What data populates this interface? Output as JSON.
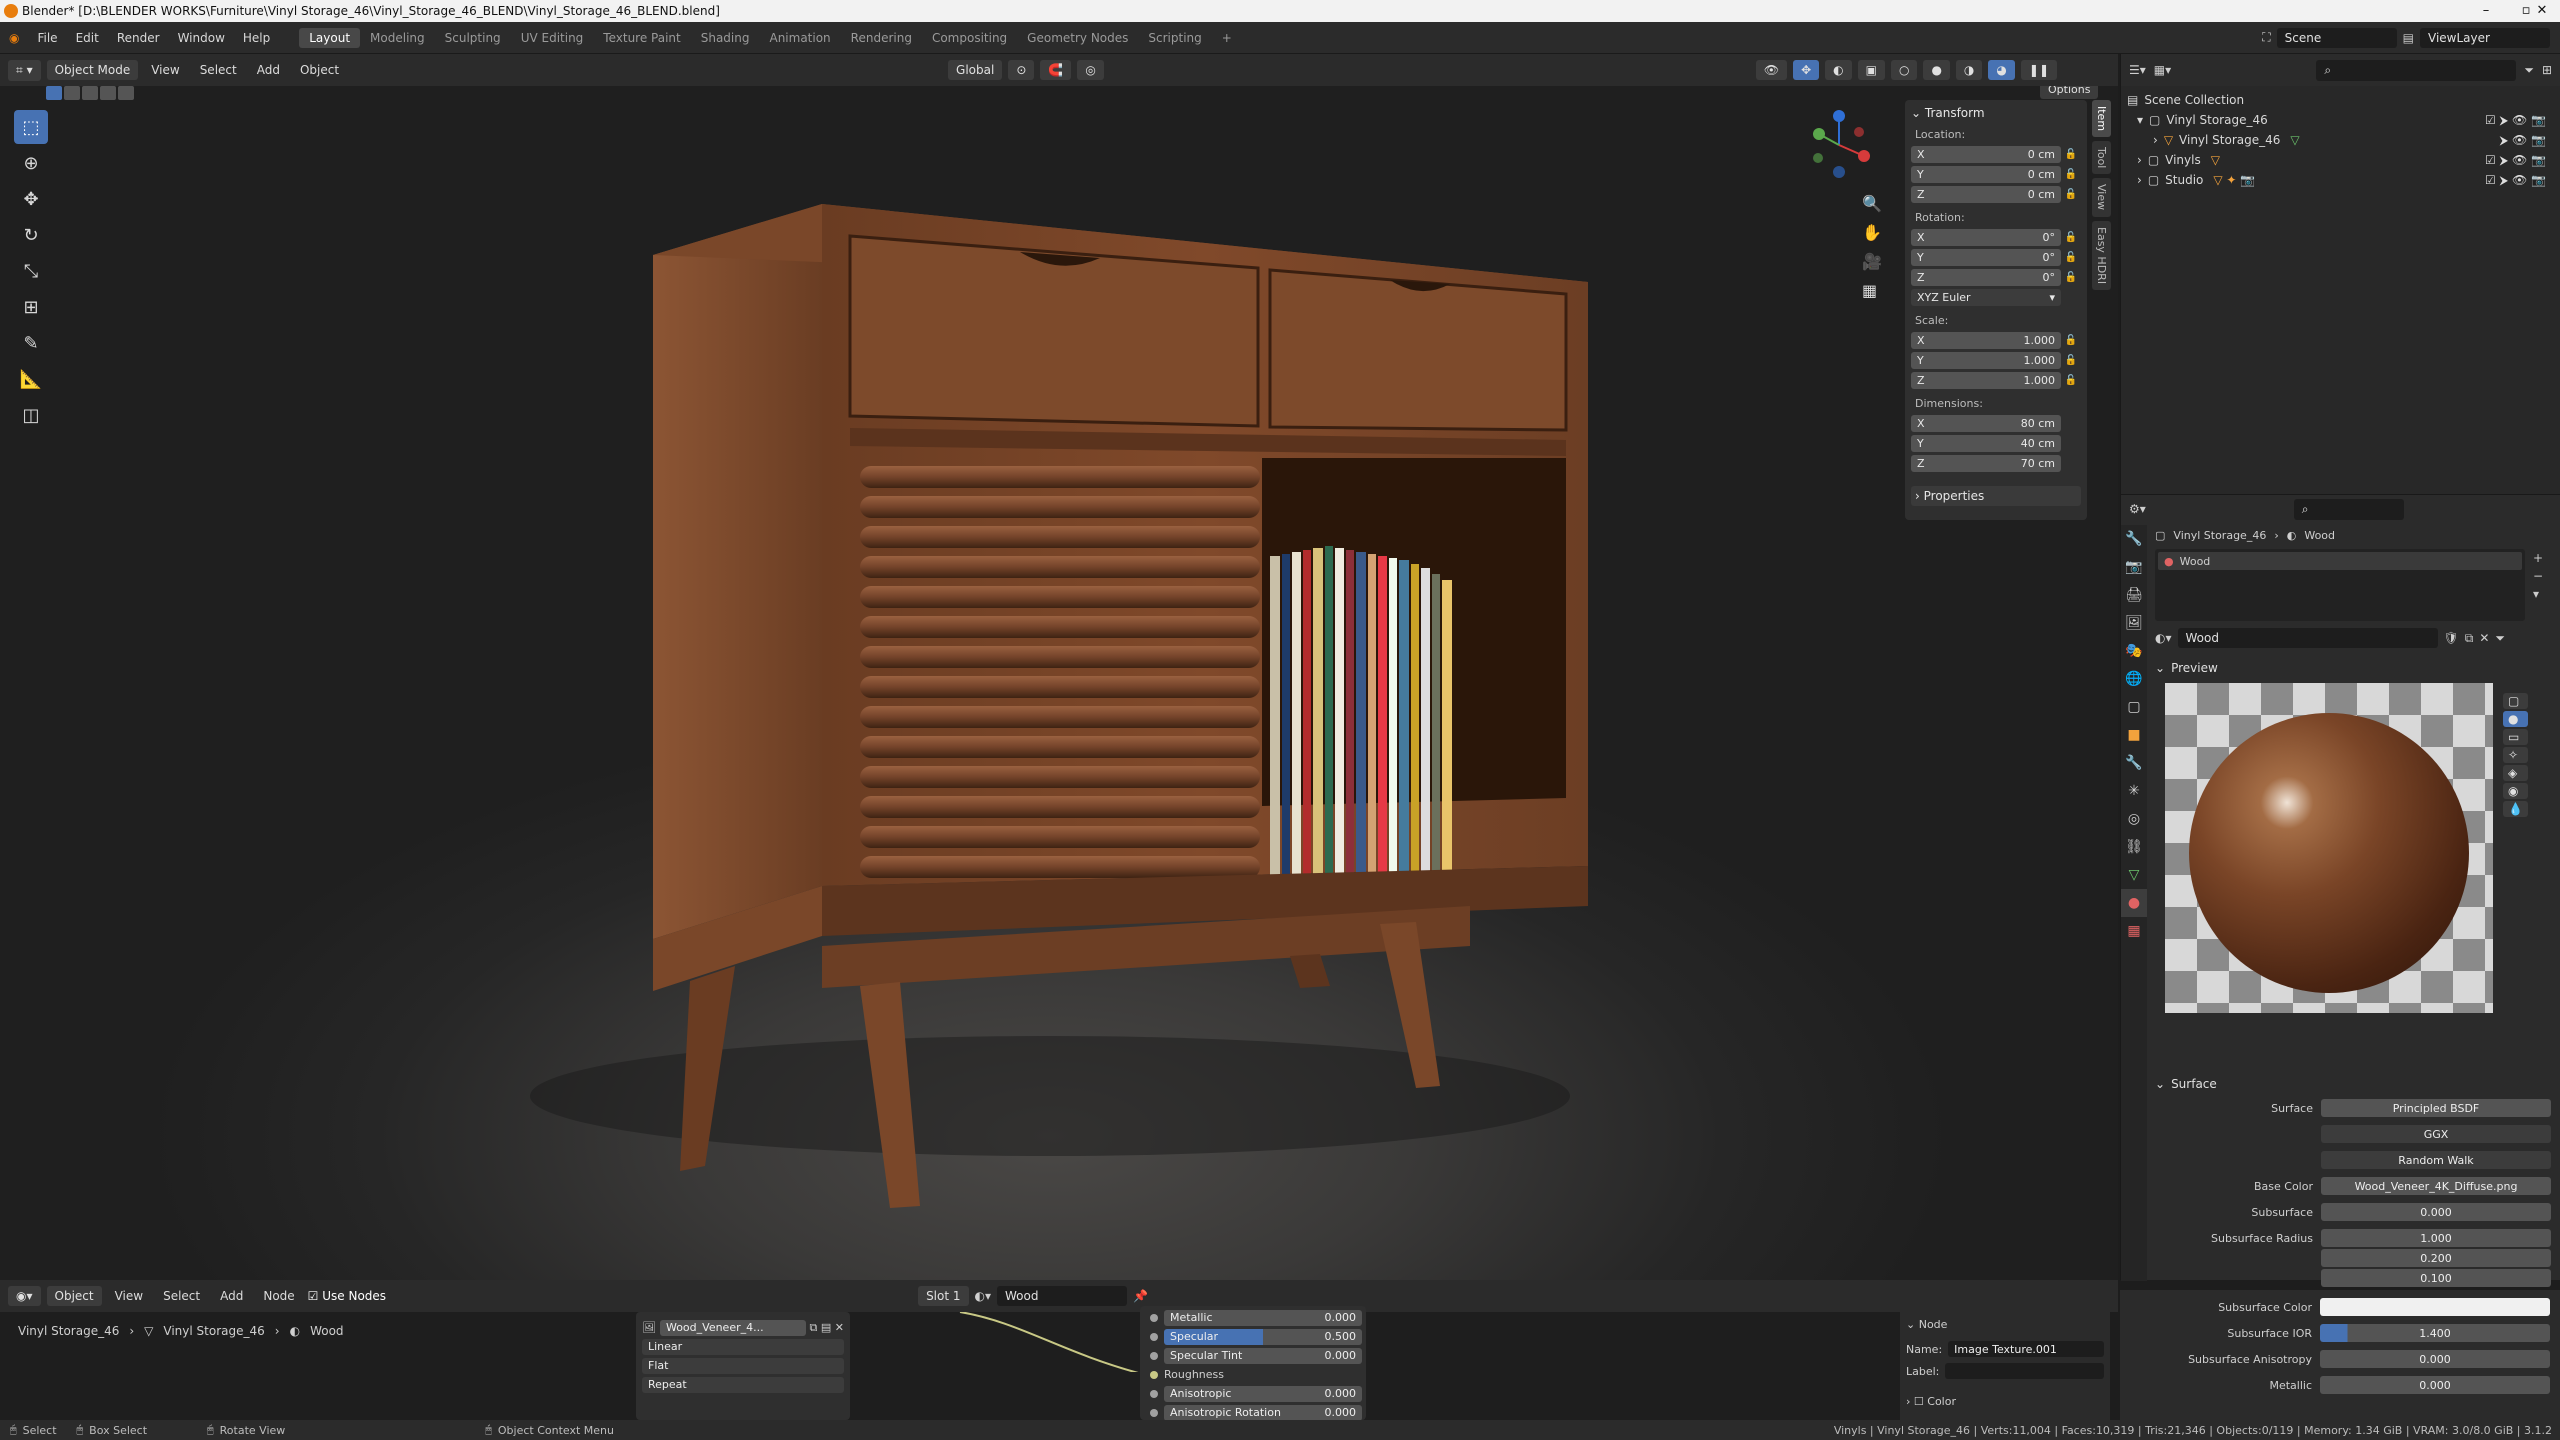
{
  "window": {
    "title": "Blender* [D:\\BLENDER WORKS\\Furniture\\Vinyl Storage_46\\Vinyl_Storage_46_BLEND\\Vinyl_Storage_46_BLEND.blend]"
  },
  "menu": [
    "File",
    "Edit",
    "Render",
    "Window",
    "Help"
  ],
  "workspaces": [
    "Layout",
    "Modeling",
    "Sculpting",
    "UV Editing",
    "Texture Paint",
    "Shading",
    "Animation",
    "Rendering",
    "Compositing",
    "Geometry Nodes",
    "Scripting"
  ],
  "top_right": {
    "scene": "Scene",
    "view_layer": "ViewLayer"
  },
  "viewport_header": {
    "mode": "Object Mode",
    "menus": [
      "View",
      "Select",
      "Add",
      "Object"
    ],
    "orientation": "Global",
    "options": "Options"
  },
  "npanel": {
    "title": "Transform",
    "location_label": "Location:",
    "location": [
      {
        "axis": "X",
        "value": "0 cm"
      },
      {
        "axis": "Y",
        "value": "0 cm"
      },
      {
        "axis": "Z",
        "value": "0 cm"
      }
    ],
    "rotation_label": "Rotation:",
    "rotation": [
      {
        "axis": "X",
        "value": "0°"
      },
      {
        "axis": "Y",
        "value": "0°"
      },
      {
        "axis": "Z",
        "value": "0°"
      }
    ],
    "rotation_mode": "XYZ Euler",
    "scale_label": "Scale:",
    "scale": [
      {
        "axis": "X",
        "value": "1.000"
      },
      {
        "axis": "Y",
        "value": "1.000"
      },
      {
        "axis": "Z",
        "value": "1.000"
      }
    ],
    "dimensions_label": "Dimensions:",
    "dimensions": [
      {
        "axis": "X",
        "value": "80 cm"
      },
      {
        "axis": "Y",
        "value": "40 cm"
      },
      {
        "axis": "Z",
        "value": "70 cm"
      }
    ],
    "properties": "Properties",
    "tabs": [
      "Item",
      "Tool",
      "View",
      "Easy HDRI"
    ]
  },
  "outliner": {
    "root": "Scene Collection",
    "items": [
      "Vinyl Storage_46",
      "Vinyl Storage_46",
      "Vinyls",
      "Studio"
    ]
  },
  "properties": {
    "breadcrumb": [
      "Vinyl Storage_46",
      "Wood"
    ],
    "slot": "Wood",
    "material": "Wood",
    "preview": "Preview",
    "surface_section": "Surface",
    "rows": [
      {
        "label": "Surface",
        "value": "Principled BSDF"
      },
      {
        "label": "",
        "value": "GGX"
      },
      {
        "label": "",
        "value": "Random Walk"
      },
      {
        "label": "Base Color",
        "value": "Wood_Veneer_4K_Diffuse.png"
      },
      {
        "label": "Subsurface",
        "value": "0.000"
      },
      {
        "label": "Subsurface Radius",
        "value": "1.000"
      },
      {
        "label": "",
        "value": "0.200"
      },
      {
        "label": "",
        "value": "0.100"
      },
      {
        "label": "Subsurface Color",
        "value": ""
      },
      {
        "label": "Subsurface IOR",
        "value": "1.400"
      },
      {
        "label": "Subsurface Anisotropy",
        "value": "0.000"
      },
      {
        "label": "Metallic",
        "value": "0.000"
      }
    ]
  },
  "node_editor": {
    "header": {
      "mode": "Object",
      "menus": [
        "View",
        "Select",
        "Add",
        "Node"
      ],
      "use_nodes": "Use Nodes",
      "slot": "Slot 1",
      "material": "Wood"
    },
    "breadcrumb": [
      "Vinyl Storage_46",
      "Vinyl Storage_46",
      "Wood"
    ],
    "texture_node": {
      "image": "Wood_Veneer_4...",
      "interp": "Linear",
      "proj": "Flat",
      "ext": "Repeat"
    },
    "bsdf_rows": [
      {
        "label": "Metallic",
        "value": "0.000"
      },
      {
        "label": "Specular",
        "value": "0.500"
      },
      {
        "label": "Specular Tint",
        "value": "0.000"
      },
      {
        "label": "Roughness",
        "value": ""
      },
      {
        "label": "Anisotropic",
        "value": "0.000"
      },
      {
        "label": "Anisotropic Rotation",
        "value": "0.000"
      }
    ],
    "side": {
      "title": "Node",
      "name_label": "Name:",
      "name": "Image Texture.001",
      "label_label": "Label:",
      "color": "Color"
    }
  },
  "status": {
    "select": "Select",
    "box_select": "Box Select",
    "rotate_view": "Rotate View",
    "context_menu": "Object Context Menu",
    "info": "Vinyls | Vinyl Storage_46 | Verts:11,004 | Faces:10,319 | Tris:21,346 | Objects:0/119 | Memory: 1.34 GiB | VRAM: 3.0/8.0 GiB | 3.1.2"
  },
  "colors": {
    "accent": "#4772b3",
    "wood": "#7a4a2c",
    "bg": "#2b2b2b"
  }
}
